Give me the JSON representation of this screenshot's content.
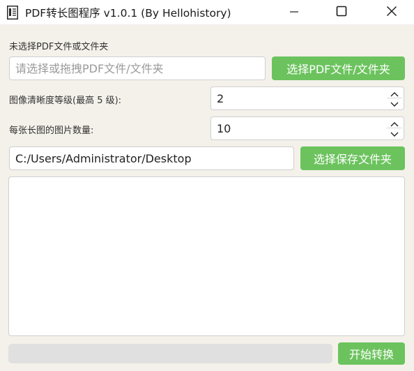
{
  "window": {
    "title": "PDF转长图程序 v1.0.1 (By Hellohistory)",
    "icon": "document-icon",
    "controls": [
      "minimize-icon",
      "maximize-icon",
      "close-icon"
    ]
  },
  "file_select": {
    "status_label": "未选择PDF文件或文件夹",
    "placeholder": "请选择或拖拽PDF文件/文件夹",
    "value": "",
    "button_label": "选择PDF文件/文件夹"
  },
  "quality": {
    "label": "图像清晰度等级(最高 5 级):",
    "value": "2"
  },
  "images_per_long": {
    "label": "每张长图的图片数量:",
    "value": "10"
  },
  "save_folder": {
    "value": "C:/Users/Administrator/Desktop",
    "button_label": "选择保存文件夹"
  },
  "log": {
    "content": ""
  },
  "progress": {
    "value": 0
  },
  "start_button_label": "开始转换",
  "colors": {
    "accent": "#6cc35e",
    "background": "#f4f1ea"
  }
}
